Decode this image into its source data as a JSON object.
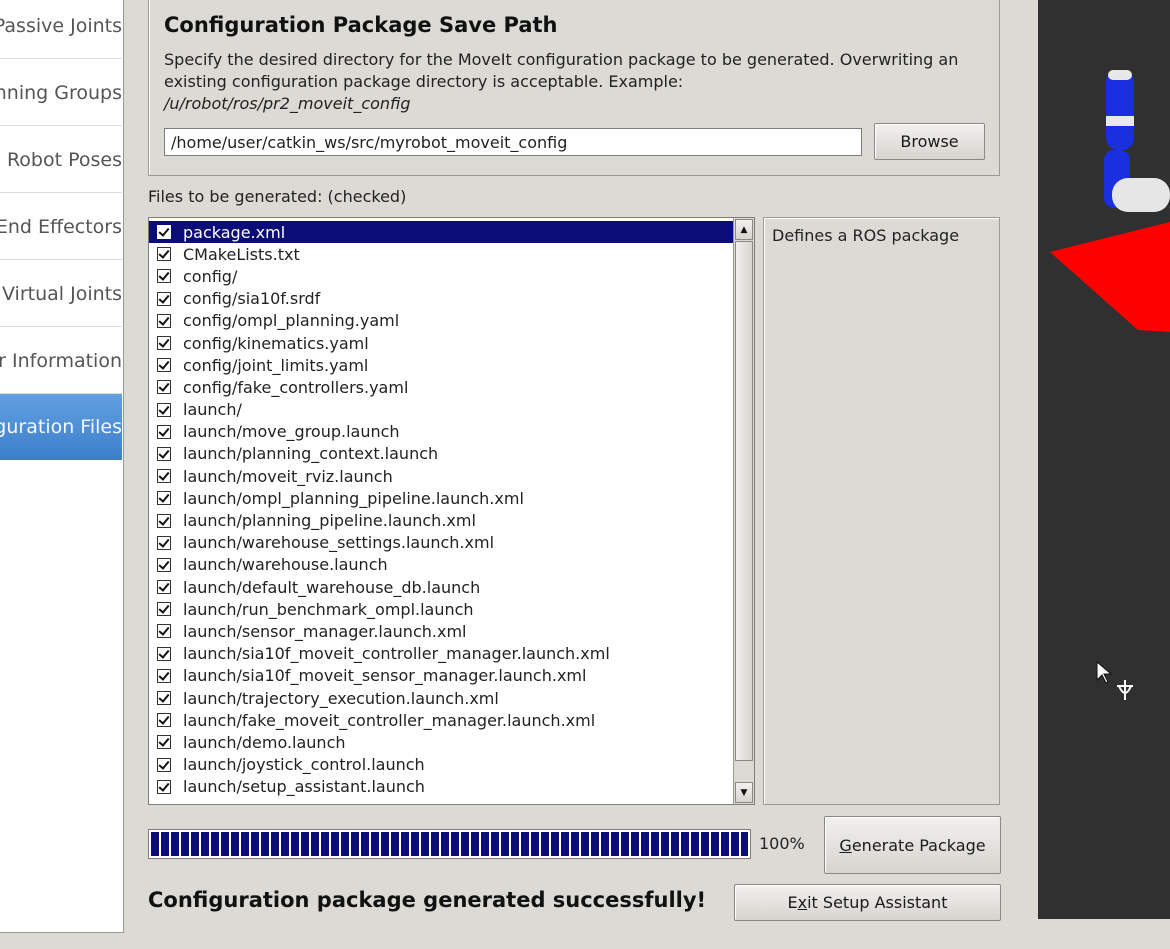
{
  "sidebar": {
    "items": [
      {
        "label": "Passive Joints",
        "active": false
      },
      {
        "label": "Planning Groups",
        "active": false
      },
      {
        "label": "Robot Poses",
        "active": false
      },
      {
        "label": "End Effectors",
        "active": false
      },
      {
        "label": "Virtual Joints",
        "active": false
      },
      {
        "label": "Author Information",
        "active": false
      },
      {
        "label": "Configuration Files",
        "active": true
      }
    ]
  },
  "save_path": {
    "title": "Configuration Package Save Path",
    "description": "Specify the desired directory for the MoveIt configuration package to be generated. Overwriting an existing configuration package directory is acceptable. Example:",
    "example": "/u/robot/ros/pr2_moveit_config",
    "path_value": "/home/user/catkin_ws/src/myrobot_moveit_config",
    "browse_label": "Browse"
  },
  "files": {
    "label": "Files to be generated: (checked)",
    "selected_index": 0,
    "items": [
      "package.xml",
      "CMakeLists.txt",
      "config/",
      "config/sia10f.srdf",
      "config/ompl_planning.yaml",
      "config/kinematics.yaml",
      "config/joint_limits.yaml",
      "config/fake_controllers.yaml",
      "launch/",
      "launch/move_group.launch",
      "launch/planning_context.launch",
      "launch/moveit_rviz.launch",
      "launch/ompl_planning_pipeline.launch.xml",
      "launch/planning_pipeline.launch.xml",
      "launch/warehouse_settings.launch.xml",
      "launch/warehouse.launch",
      "launch/default_warehouse_db.launch",
      "launch/run_benchmark_ompl.launch",
      "launch/sensor_manager.launch.xml",
      "launch/sia10f_moveit_controller_manager.launch.xml",
      "launch/sia10f_moveit_sensor_manager.launch.xml",
      "launch/trajectory_execution.launch.xml",
      "launch/fake_moveit_controller_manager.launch.xml",
      "launch/demo.launch",
      "launch/joystick_control.launch",
      "launch/setup_assistant.launch"
    ],
    "description": "Defines a ROS package"
  },
  "progress": {
    "percent": 100,
    "text": "100%"
  },
  "buttons": {
    "generate_prefix": "G",
    "generate_rest": "enerate Package",
    "exit_pre": "E",
    "exit_ul": "x",
    "exit_rest": "it Setup Assistant"
  },
  "status": "Configuration package generated successfully!",
  "colors": {
    "selection": "#0b0c78",
    "sidebar_active": "#3d7fcb",
    "robot_link": "#1a2fe0",
    "floor": "#ff0000",
    "viewport_bg": "#303030"
  }
}
